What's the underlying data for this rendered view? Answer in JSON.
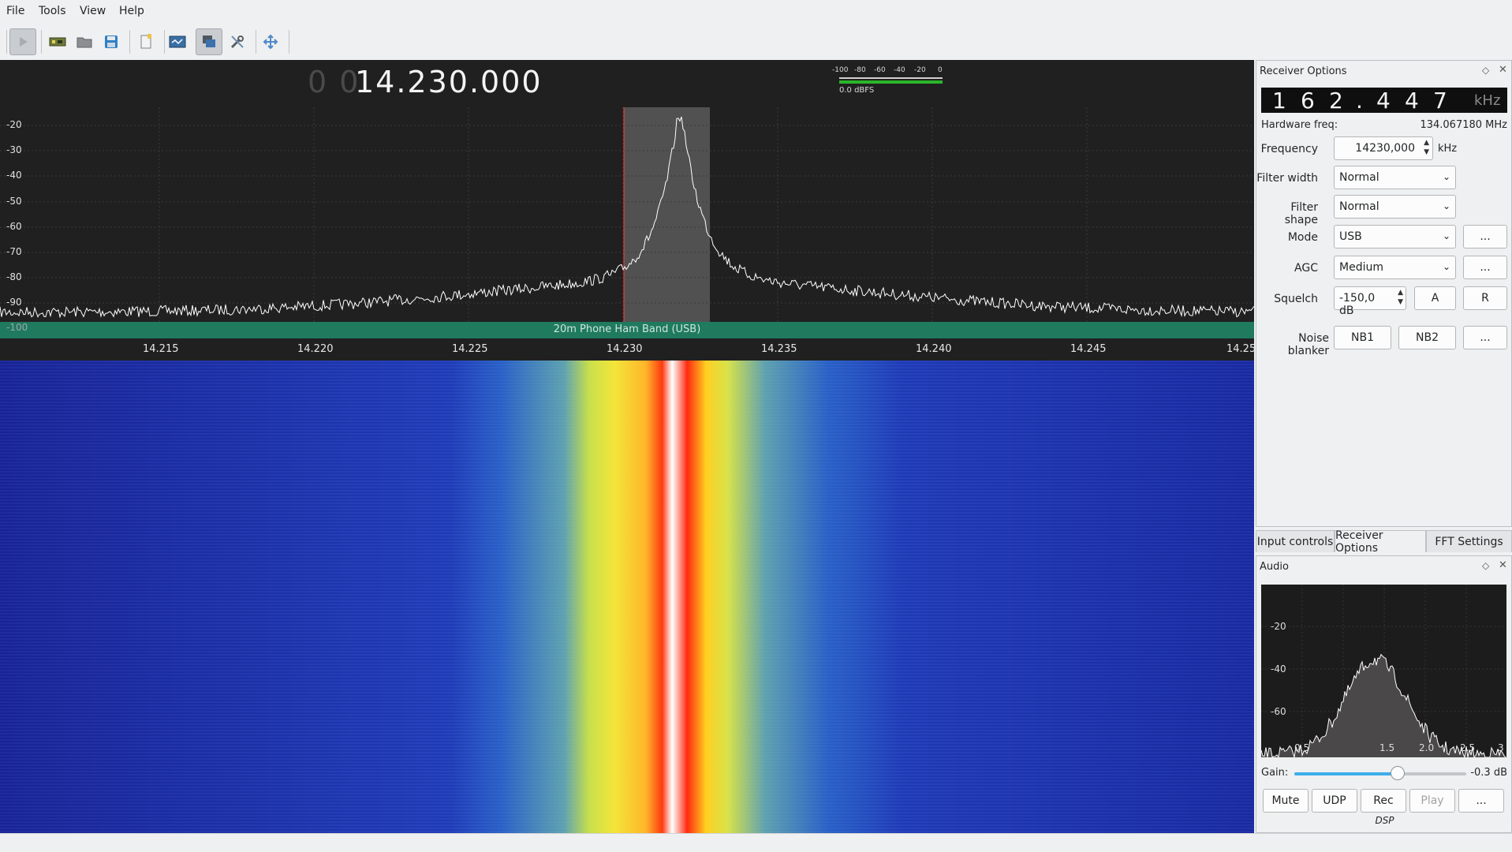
{
  "menu": [
    "File",
    "Tools",
    "View",
    "Help"
  ],
  "toolbar": {
    "buttons": [
      "start-icon",
      "device-icon",
      "open-folder-icon",
      "save-icon",
      "bookmark-icon",
      "remote-control-icon",
      "dsp-icon",
      "settings-icon",
      "fullscreen-icon"
    ]
  },
  "display": {
    "freq_leading": "0 0",
    "freq_main": "14.230.000",
    "meter_ticks": [
      "-100",
      "-80",
      "-60",
      "-40",
      "-20",
      "0"
    ],
    "meter_value": "0.0 dBFS",
    "db_ticks": [
      "-20",
      "-30",
      "-40",
      "-50",
      "-60",
      "-70",
      "-80",
      "-90",
      "-100"
    ],
    "freq_ticks": [
      "14.215",
      "14.220",
      "14.225",
      "14.230",
      "14.235",
      "14.240",
      "14.245",
      "14.25"
    ],
    "band_label": "20m Phone Ham Band (USB)"
  },
  "receiver": {
    "title": "Receiver Options",
    "offset_digits": [
      "1",
      "6",
      "2",
      ".",
      "4",
      "4",
      "7"
    ],
    "offset_unit": "kHz",
    "hw_freq_label": "Hardware freq:",
    "hw_freq_value": "134.067180 MHz",
    "frequency_label": "Frequency",
    "frequency_value": "14230,000",
    "frequency_unit": "kHz",
    "filter_width_label": "Filter width",
    "filter_width_value": "Normal",
    "filter_shape_label": "Filter shape",
    "filter_shape_value": "Normal",
    "mode_label": "Mode",
    "mode_value": "USB",
    "agc_label": "AGC",
    "agc_value": "Medium",
    "squelch_label": "Squelch",
    "squelch_value": "-150,0 dB",
    "squelch_a": "A",
    "squelch_r": "R",
    "noise_blanker_label": "Noise blanker",
    "nb1": "NB1",
    "nb2": "NB2",
    "more": "..."
  },
  "tabs": [
    "Input controls",
    "Receiver Options",
    "FFT Settings"
  ],
  "audio": {
    "title": "Audio",
    "db_ticks": [
      "-20",
      "-40",
      "-60"
    ],
    "freq_ticks": [
      "0.5",
      "1.5",
      "2.0",
      "2.5",
      "3"
    ],
    "gain_label": "Gain:",
    "gain_value": "-0.3 dB",
    "gain_level": 0.6,
    "buttons": [
      "Mute",
      "UDP",
      "Rec",
      "Play",
      "..."
    ],
    "dsp_label": "DSP"
  },
  "colors": {
    "accent": "#3daee9",
    "band_bar": "#1f7a5e",
    "waterfall_low": "#1a2fa8",
    "waterfall_peak": "#ff2000"
  }
}
